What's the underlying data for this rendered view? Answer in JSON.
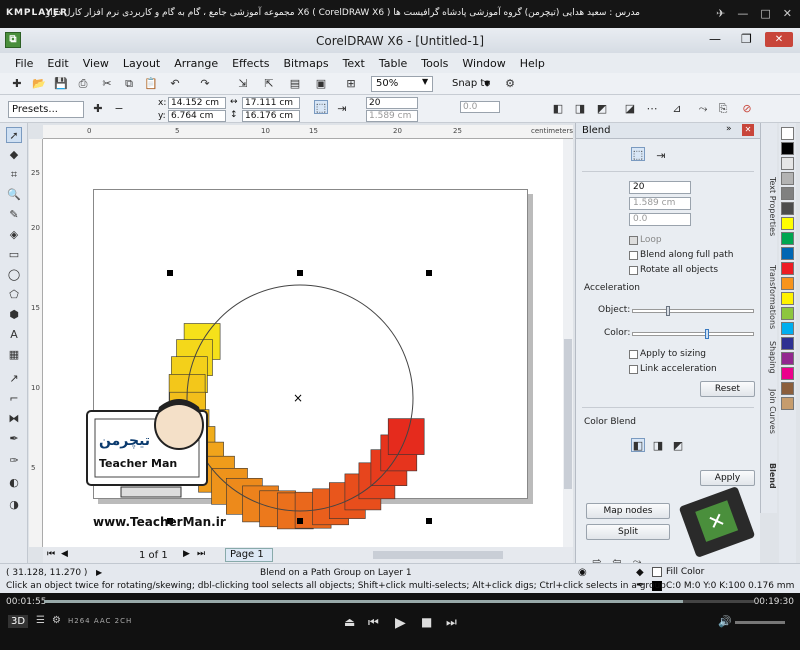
{
  "player": {
    "logo": "KMPLAYER",
    "title": "مجموعه آموزشی جامع ، گام به گام و کاربردی نرم افزار کارل دراو X6 ( CorelDRAW X6 )  مدرس : سعید هدایی (تیچرمن) گروه آموزشی پادشاه گرافیست ها",
    "time_elapsed": "00:01:55",
    "time_total": "00:19:30",
    "progress_fraction": 0.9,
    "codec": "H264  AAC  2CH",
    "controls": [
      "⏏",
      "⏮",
      "▶",
      "■",
      "⏭"
    ]
  },
  "app": {
    "title": "CorelDRAW X6 - [Untitled-1]",
    "menu": [
      "File",
      "Edit",
      "View",
      "Layout",
      "Arrange",
      "Effects",
      "Bitmaps",
      "Text",
      "Table",
      "Tools",
      "Window",
      "Help"
    ],
    "zoom": "50%",
    "snap_to": "Snap to",
    "presets": "Presets...",
    "x_value": "14.152 cm",
    "y_value": "6.764 cm",
    "w_value": "17.111 cm",
    "h_value": "16.176 cm",
    "steps": "20",
    "spacing": "1.589 cm",
    "angle": "0.0",
    "ruler_unit": "centimeters",
    "ruler_h_ticks": [
      "0",
      "5",
      "10",
      "15",
      "20",
      "25"
    ],
    "ruler_v_ticks": [
      "25",
      "20",
      "15",
      "10",
      "5"
    ],
    "page_count": "1 of 1",
    "page_tab": "Page 1"
  },
  "docker": {
    "title": "Blend",
    "steps": "20",
    "spacing": "1.589 cm",
    "angle": "0.0",
    "loop": "Loop",
    "blend_full_path": "Blend along full path",
    "rotate_all": "Rotate all objects",
    "acceleration": "Acceleration",
    "object_label": "Object:",
    "color_label": "Color:",
    "apply_sizing": "Apply to sizing",
    "link_acceleration": "Link acceleration",
    "reset": "Reset",
    "color_blend": "Color Blend",
    "apply": "Apply",
    "map_nodes": "Map nodes",
    "split": "Split"
  },
  "side_tabs": [
    "Text Properties",
    "Transformations",
    "Shaping",
    "Join Curves",
    "Blend"
  ],
  "watermark": {
    "url": "www.TeacherMan.ir"
  },
  "status": {
    "coords": "( 31.128, 11.270 )",
    "layer_info": "Blend on a Path Group on Layer 1",
    "hint": "Click an object twice for rotating/skewing; dbl-clicking tool selects all objects; Shift+click multi-selects; Alt+click digs; Ctrl+click selects in a group",
    "fill": "Fill Color",
    "outline": "C:0 M:0 Y:0 K:100  0.176 mm"
  },
  "colors": {
    "accent": "#4a8f3c",
    "blend_start": "#f5e11a",
    "blend_end": "#e52b1d",
    "palette": [
      "#ffffff",
      "#000000",
      "#e6e6e6",
      "#b3b3b3",
      "#808080",
      "#4d4d4d",
      "#ffff00",
      "#00a651",
      "#0066b3",
      "#ed1c24",
      "#f7941d",
      "#fff200",
      "#8dc63f",
      "#00aeef",
      "#2e3192",
      "#92278f",
      "#ec008c",
      "#8b5e3c",
      "#c69c6d"
    ],
    "bottom_palette": [
      "#e52b1d",
      "#f5821f",
      "#f7c51a",
      "#00a651",
      "#1c5fa8",
      "#e6e6e6",
      "#c0c0c0"
    ]
  }
}
